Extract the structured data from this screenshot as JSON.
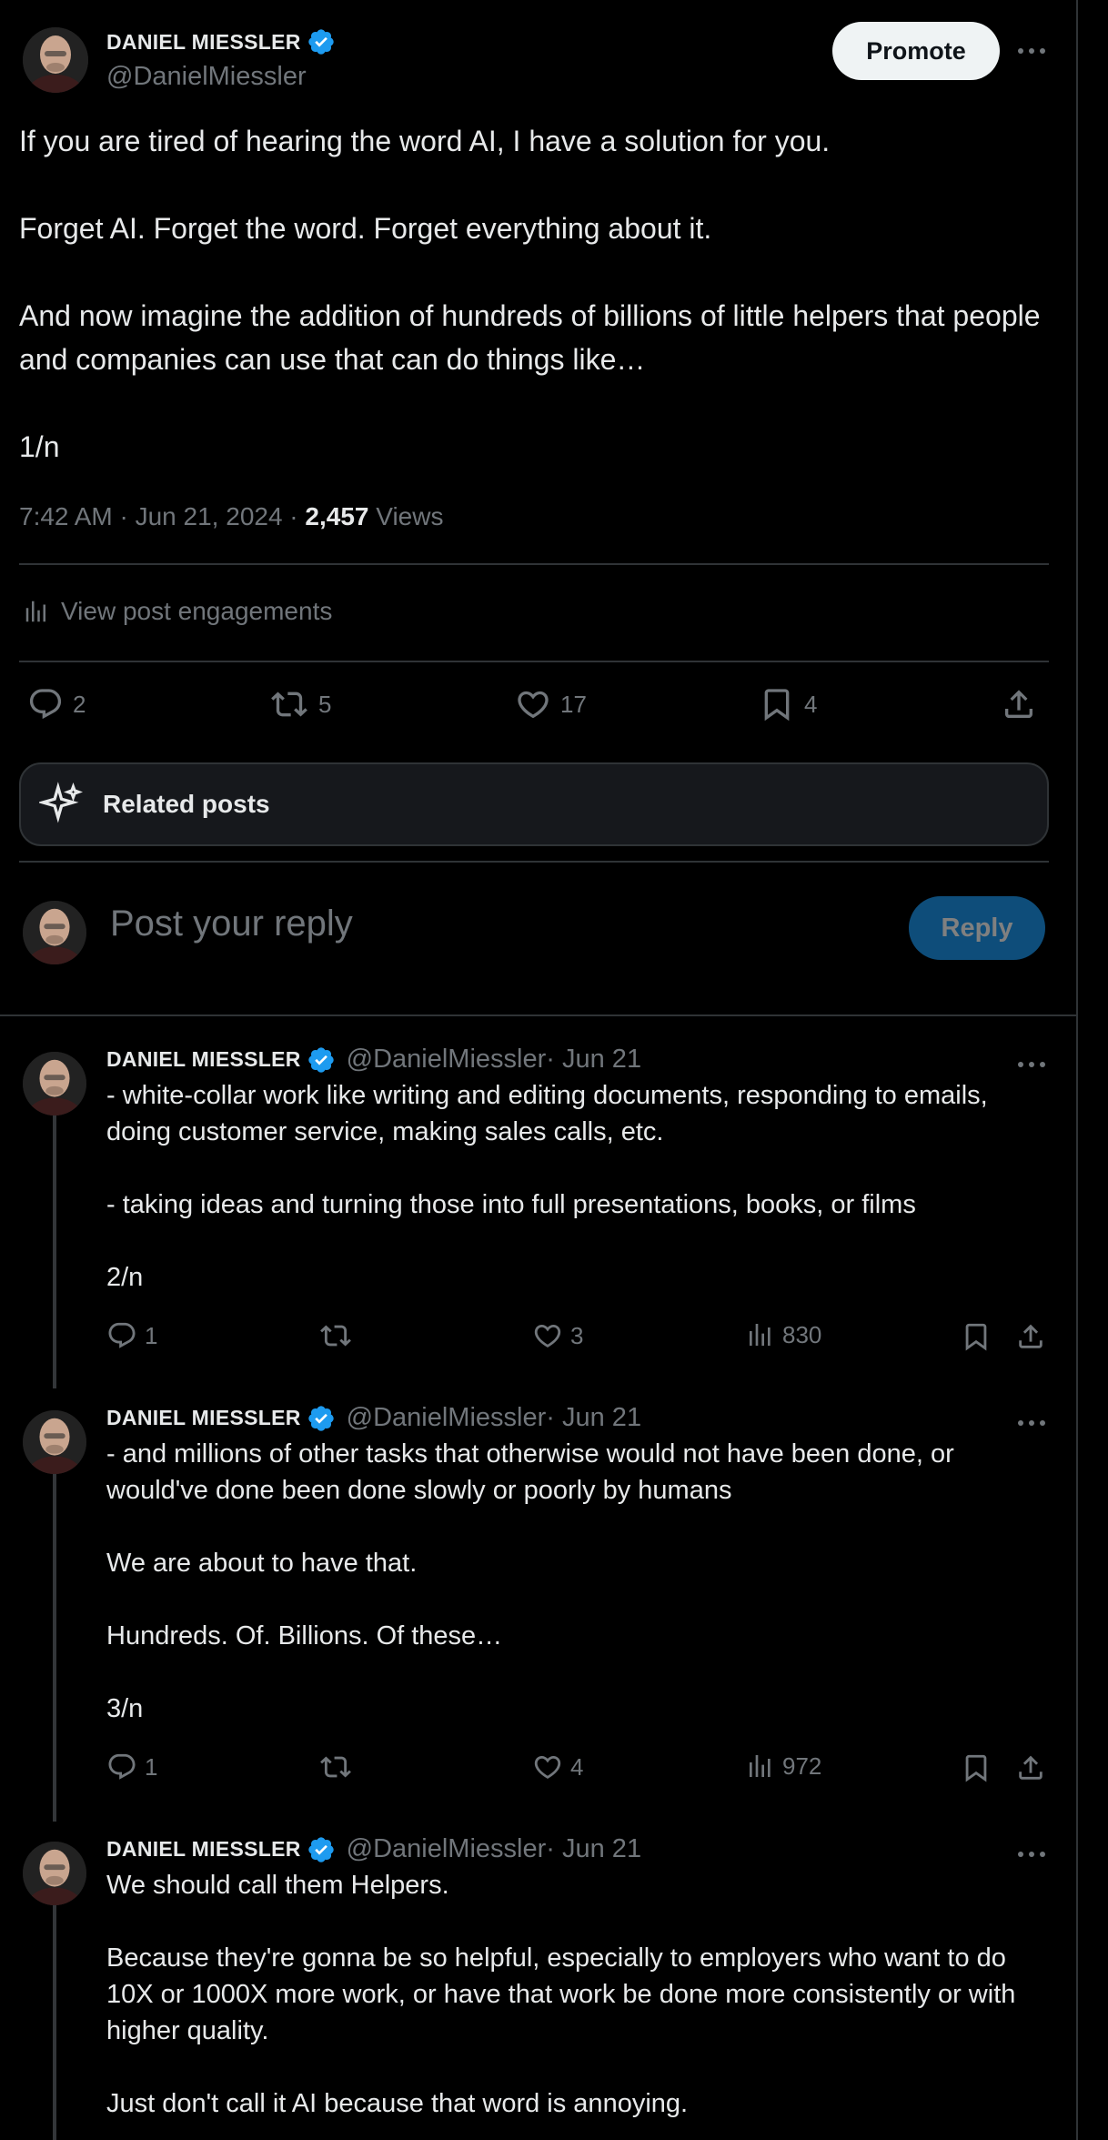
{
  "author": {
    "name": "DANIEL MIESSLER",
    "handle": "@DanielMiessler"
  },
  "header": {
    "promote_label": "Promote"
  },
  "main_post": {
    "text": "If you are tired of hearing the word AI, I have a solution for you.\n\nForget AI. Forget the word. Forget everything about it.\n\nAnd now imagine the addition of hundreds of billions of little helpers that people and companies can use that can do things like…\n\n1/n",
    "time": "7:42 AM · Jun 21, 2024 · ",
    "views": "2,457",
    "views_label": " Views",
    "engagements_label": "View post engagements",
    "stats": {
      "replies": "2",
      "reposts": "5",
      "likes": "17",
      "bookmarks": "4"
    }
  },
  "related": {
    "label": "Related posts"
  },
  "compose": {
    "placeholder": "Post your reply",
    "reply_label": "Reply"
  },
  "replies": [
    {
      "date": " · Jun 21",
      "text": "- white-collar work like writing and editing documents, responding to emails, doing customer service, making sales calls, etc.\n\n- taking ideas and turning those into full presentations, books, or films\n\n2/n",
      "replies": "1",
      "reposts": "",
      "likes": "3",
      "views": "830"
    },
    {
      "date": " · Jun 21",
      "text": "- and millions of other tasks that otherwise would not have been done, or would've done been done slowly or poorly by humans\n\nWe are about to have that.\n\nHundreds. Of. Billions. Of these…\n\n3/n",
      "replies": "1",
      "reposts": "",
      "likes": "4",
      "views": "972"
    },
    {
      "date": " · Jun 21",
      "text": "We should call them Helpers.\n\nBecause they're gonna be so helpful, especially to employers who want to do 10X or 1000X more work, or have that work be done more consistently or with higher quality.\n\nJust don't call it AI because that word is annoying."
    }
  ],
  "colors": {
    "background": "#000000",
    "text": "#e7e9ea",
    "muted": "#71767b",
    "divider": "#2f3336",
    "verified": "#1d9bf0",
    "reply_button": "#0e4d7a"
  }
}
